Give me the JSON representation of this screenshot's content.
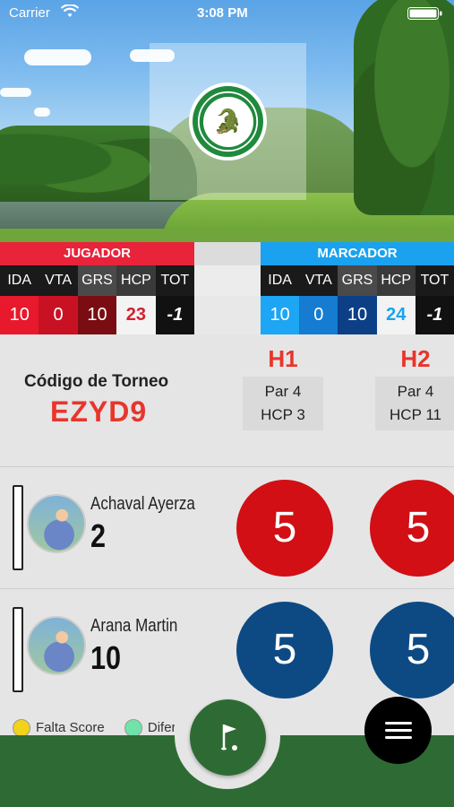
{
  "status_bar": {
    "carrier": "Carrier",
    "time": "3:08 PM"
  },
  "club": {
    "logo_text": "Los Lagartos Country Club"
  },
  "player_panel": {
    "title": "JUGADOR",
    "labels": [
      "IDA",
      "VTA",
      "GRS",
      "HCP",
      "TOT"
    ],
    "values": [
      "10",
      "0",
      "10",
      "23",
      "-1"
    ]
  },
  "marker_panel": {
    "title": "MARCADOR",
    "labels": [
      "IDA",
      "VTA",
      "GRS",
      "HCP",
      "TOT"
    ],
    "values": [
      "10",
      "0",
      "10",
      "24",
      "-1"
    ]
  },
  "tournament": {
    "code_label": "Código de Torneo",
    "code": "EZYD9"
  },
  "holes": [
    {
      "name": "H1",
      "par": "Par 4",
      "hcp": "HCP 3"
    },
    {
      "name": "H2",
      "par": "Par 4",
      "hcp": "HCP 11"
    }
  ],
  "players": [
    {
      "name": "Achaval Ayerza",
      "handicap": "2",
      "scores": [
        "5",
        "5"
      ],
      "color": "#d10f14"
    },
    {
      "name": "Arana Martin",
      "handicap": "10",
      "scores": [
        "5",
        "5"
      ],
      "color": "#0d4a84"
    }
  ],
  "legend": [
    {
      "label": "Falta Score",
      "color": "#f2d21a"
    },
    {
      "label": "Diferen",
      "color": "#6fe3a8"
    }
  ],
  "colors": {
    "primary_green": "#2e6b34",
    "accent_red": "#e8233a",
    "accent_blue": "#1aa2f0"
  }
}
